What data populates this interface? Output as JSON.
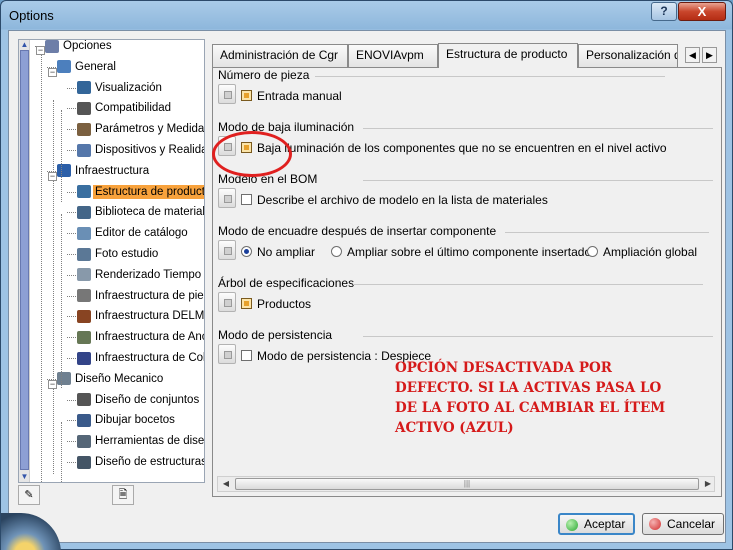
{
  "window": {
    "title": "Options",
    "help_label": "?",
    "close_label": "X"
  },
  "tree": {
    "items": [
      {
        "label": "Opciones",
        "icon": "options-root-icon",
        "color": "#6d7ea8"
      },
      {
        "label": "General",
        "icon": "general-icon",
        "color": "#4c7fbd"
      },
      {
        "label": "Visualización",
        "icon": "display-icon",
        "color": "#336699"
      },
      {
        "label": "Compatibilidad",
        "icon": "compatibility-icon",
        "color": "#555555"
      },
      {
        "label": "Parámetros y Medidas",
        "icon": "parameters-icon",
        "color": "#7b6040"
      },
      {
        "label": "Dispositivos y Realidad V",
        "icon": "devices-icon",
        "color": "#5577aa"
      },
      {
        "label": "Infraestructura",
        "icon": "infrastructure-icon",
        "color": "#2c5fa8"
      },
      {
        "label": "Estructura de producto",
        "icon": "product-structure-icon",
        "color": "#3a6fa0",
        "selected": true
      },
      {
        "label": "Biblioteca de materiales",
        "icon": "material-library-icon",
        "color": "#446688"
      },
      {
        "label": "Editor de catálogo",
        "icon": "catalog-editor-icon",
        "color": "#6a8fb5"
      },
      {
        "label": "Foto estudio",
        "icon": "photo-studio-icon",
        "color": "#5b7896"
      },
      {
        "label": "Renderizado Tiempo Rea",
        "icon": "realtime-render-icon",
        "color": "#8899aa"
      },
      {
        "label": "Infraestructura de piezas",
        "icon": "part-infrastructure-icon",
        "color": "#777777"
      },
      {
        "label": "Infraestructura DELMIA",
        "icon": "delmia-icon",
        "color": "#884422"
      },
      {
        "label": "Infraestructura de Anotac",
        "icon": "annotation-icon",
        "color": "#667755"
      },
      {
        "label": "Infraestructura de Colabo",
        "icon": "collaboration-icon",
        "color": "#334488"
      },
      {
        "label": "Diseño Mecanico",
        "icon": "mechanical-design-icon",
        "color": "#6f8090"
      },
      {
        "label": "Diseño de conjuntos",
        "icon": "assembly-design-icon",
        "color": "#555555"
      },
      {
        "label": "Dibujar bocetos",
        "icon": "sketcher-icon",
        "color": "#3a5a8a"
      },
      {
        "label": "Herramientas de diseño d",
        "icon": "design-tools-icon",
        "color": "#556677"
      },
      {
        "label": "Diseño de estructuras",
        "icon": "structure-design-icon",
        "color": "#445566"
      }
    ],
    "toolbar": {
      "btn1": "✎",
      "btn2": "🗎"
    }
  },
  "tabs": [
    {
      "label": "Administración de Cgr",
      "active": false
    },
    {
      "label": "ENOVIAvpm",
      "active": false
    },
    {
      "label": "Estructura de producto",
      "active": true
    },
    {
      "label": "Personalización d",
      "active": false
    }
  ],
  "tab_arrows": {
    "left": "◀",
    "right": "▶"
  },
  "groups": [
    {
      "title": "Número de pieza",
      "options": [
        {
          "type": "checkbox",
          "checked": true,
          "label": "Entrada manual"
        }
      ]
    },
    {
      "title": "Modo de baja iluminación",
      "options": [
        {
          "type": "checkbox",
          "checked": true,
          "label": "Baja iluminación de los componentes que no se encuentren en el nivel activo"
        }
      ]
    },
    {
      "title": "Modelo en el BOM",
      "options": [
        {
          "type": "checkbox",
          "checked": false,
          "label": "Describe el archivo de modelo en la lista de materiales"
        }
      ]
    },
    {
      "title": "Modo de encuadre después de  insertar componente",
      "options": [
        {
          "type": "radio",
          "checked": true,
          "label": "No ampliar"
        },
        {
          "type": "radio",
          "checked": false,
          "label": "Ampliar sobre el último componente insertado"
        },
        {
          "type": "radio",
          "checked": false,
          "label": "Ampliación global"
        }
      ]
    },
    {
      "title": "Árbol de especificaciones",
      "options": [
        {
          "type": "checkbox",
          "checked": true,
          "label": "Productos"
        }
      ]
    },
    {
      "title": "Modo de persistencia",
      "options": [
        {
          "type": "checkbox",
          "checked": false,
          "label": "Modo de persistencia : Despiece"
        }
      ]
    }
  ],
  "annotation": {
    "lines": [
      "OPCIÓN DESACTIVADA POR",
      "DEFECTO. SI LA ACTIVAS PASA LO",
      "DE LA FOTO AL CAMBIAR EL ÍTEM",
      "ACTIVO (AZUL)"
    ],
    "color": "#d51a1a"
  },
  "buttons": {
    "ok": {
      "label": "Aceptar",
      "icon_color": "#2aa832"
    },
    "cancel": {
      "label": "Cancelar",
      "icon_color": "#d22c2c"
    }
  },
  "hscroll": {
    "left": "◀",
    "right": "▶",
    "grip": "|||"
  }
}
